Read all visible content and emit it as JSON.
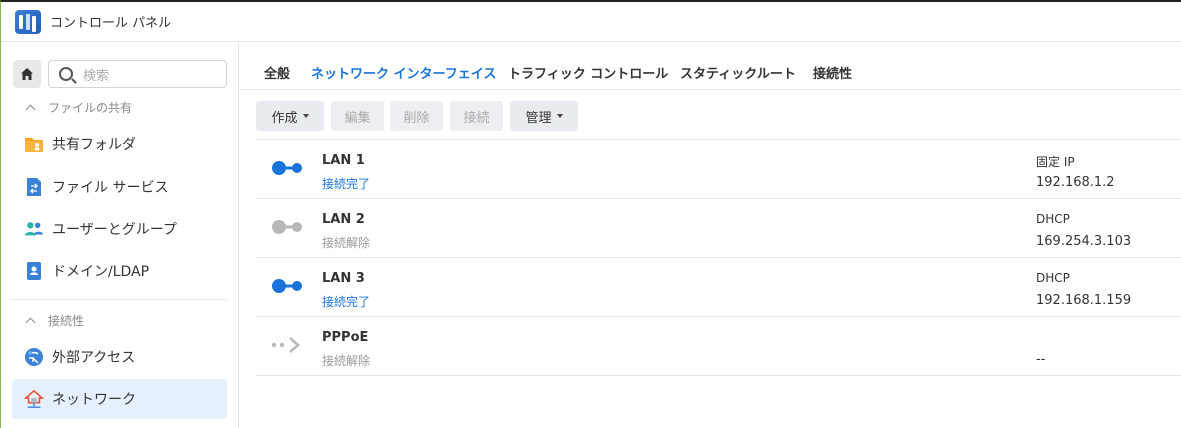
{
  "app": {
    "title": "コントロール パネル"
  },
  "sidebar": {
    "search_placeholder": "検索",
    "sections": [
      {
        "label": "ファイルの共有"
      },
      {
        "label": "接続性"
      }
    ],
    "items": [
      {
        "label": "共有フォルダ",
        "icon": "folder-share-icon",
        "color": "#f5a623"
      },
      {
        "label": "ファイル サービス",
        "icon": "file-services-icon",
        "color": "#3b82d6"
      },
      {
        "label": "ユーザーとグループ",
        "icon": "users-group-icon",
        "color": "#2bb5a8"
      },
      {
        "label": "ドメイン/LDAP",
        "icon": "domain-ldap-icon",
        "color": "#3b82d6"
      },
      {
        "label": "外部アクセス",
        "icon": "external-access-icon",
        "color": "#3b82d6"
      },
      {
        "label": "ネットワーク",
        "icon": "network-house-icon",
        "color": "#e8543a",
        "active": true
      }
    ]
  },
  "tabs": [
    {
      "label": "全般"
    },
    {
      "label": "ネットワーク インターフェイス",
      "active": true
    },
    {
      "label": "トラフィック コントロール"
    },
    {
      "label": "スタティックルート"
    },
    {
      "label": "接続性"
    }
  ],
  "toolbar": {
    "create": "作成",
    "edit": "編集",
    "delete": "削除",
    "connect": "接続",
    "manage": "管理"
  },
  "interfaces": [
    {
      "name": "LAN 1",
      "status": "接続完了",
      "mode": "固定 IP",
      "ip": "192.168.1.2",
      "connected": true
    },
    {
      "name": "LAN 2",
      "status": "接続解除",
      "mode": "DHCP",
      "ip": "169.254.3.103",
      "connected": false
    },
    {
      "name": "LAN 3",
      "status": "接続完了",
      "mode": "DHCP",
      "ip": "192.168.1.159",
      "connected": true
    },
    {
      "name": "PPPoE",
      "status": "接続解除",
      "mode": "",
      "ip": "--",
      "connected": false
    }
  ],
  "colors": {
    "accent": "#1a73d9",
    "active_bg": "#e5f0fc",
    "muted": "#999999"
  }
}
